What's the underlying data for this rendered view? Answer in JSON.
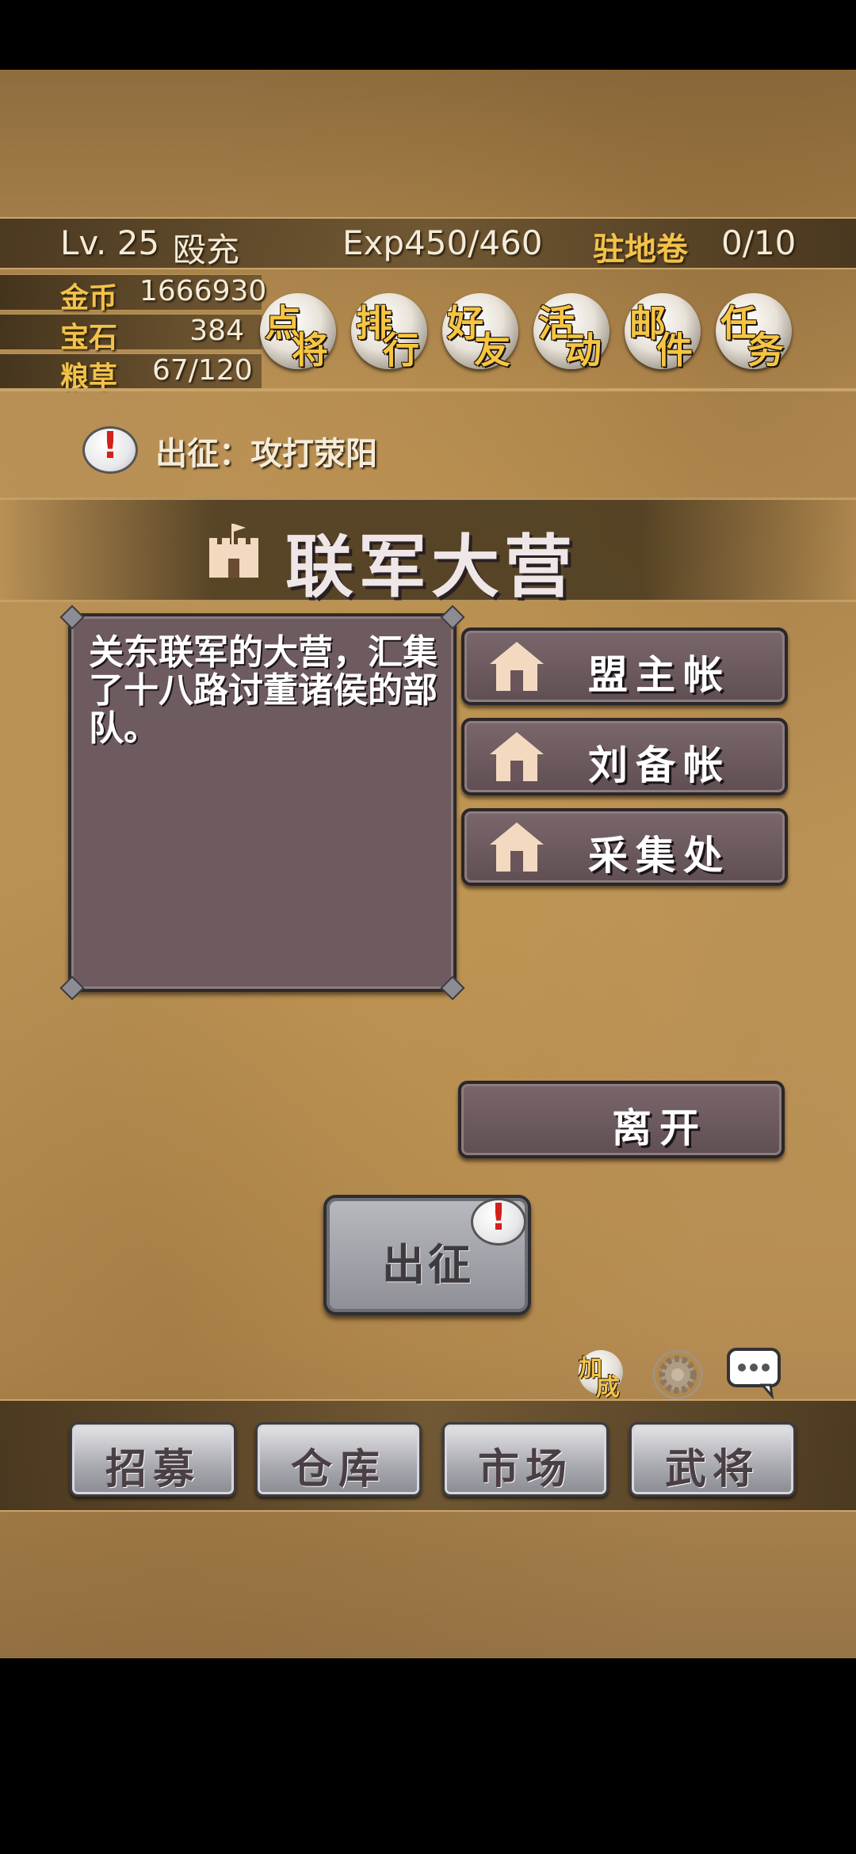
{
  "player": {
    "level_label": "Lv. 25",
    "name": "殴充",
    "exp_label": "Exp450/460",
    "garrison_label": "驻地卷",
    "garrison_value": "0/10"
  },
  "resources": [
    {
      "label": "金币",
      "value": "1666930"
    },
    {
      "label": "宝石",
      "value": "384"
    },
    {
      "label": "粮草",
      "value": "67/120"
    }
  ],
  "menu_circles": [
    {
      "top": "点",
      "bottom": "将"
    },
    {
      "top": "排",
      "bottom": "行"
    },
    {
      "top": "好",
      "bottom": "友"
    },
    {
      "top": "活",
      "bottom": "动"
    },
    {
      "top": "邮",
      "bottom": "件"
    },
    {
      "top": "任",
      "bottom": "务"
    }
  ],
  "quest": {
    "text": "出征：攻打荥阳",
    "alert_glyph": "!"
  },
  "location": {
    "title": "联军大营",
    "description": "关东联军的大营，汇集了十八路讨董诸侯的部队。"
  },
  "actions": [
    {
      "label": "盟主帐"
    },
    {
      "label": "刘备帐"
    },
    {
      "label": "采集处"
    }
  ],
  "leave_label": "离开",
  "march": {
    "label": "出征",
    "alert_glyph": "!"
  },
  "bottom_icons": {
    "bonus_top": "加",
    "bonus_bottom": "成"
  },
  "bottom_nav": [
    {
      "label": "招募"
    },
    {
      "label": "仓库"
    },
    {
      "label": "市场"
    },
    {
      "label": "武将"
    }
  ],
  "colors": {
    "gold": "#f2c24a",
    "panel": "#6d5b60",
    "alert": "#d2211c"
  }
}
